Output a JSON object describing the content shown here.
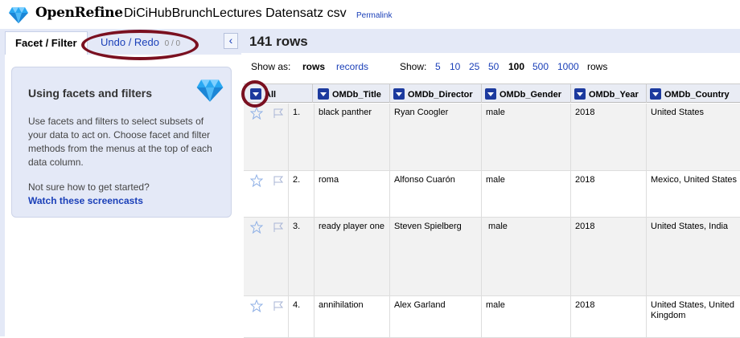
{
  "header": {
    "app_name": "OpenRefine",
    "project_name": "DiCiHubBrunchLectures Datensatz csv",
    "permalink": "Permalink"
  },
  "left_panel": {
    "tabs": {
      "facet": "Facet / Filter",
      "undo": "Undo / Redo",
      "undo_count": "0 / 0"
    },
    "collapse_icon": "chevron-left-icon",
    "help": {
      "title": "Using facets and filters",
      "text": "Use facets and filters to select subsets of your data to act on. Choose facet and filter methods from the menus at the top of each data column.",
      "question": "Not sure how to get started?",
      "link": "Watch these screencasts"
    }
  },
  "summary": {
    "rows": "141 rows"
  },
  "view_bar": {
    "show_as_label": "Show as:",
    "rows_mode": "rows",
    "records_mode": "records",
    "show_label": "Show:",
    "page_sizes": [
      "5",
      "10",
      "25",
      "50",
      "100",
      "500",
      "1000"
    ],
    "selected_size": "100",
    "unit": "rows"
  },
  "grid": {
    "all_label": "All",
    "columns": [
      "OMDb_Title",
      "OMDb_Director",
      "OMDb_Gender",
      "OMDb_Year",
      "OMDb_Country"
    ],
    "rows": [
      {
        "index": "1.",
        "cells": [
          "black panther",
          "Ryan Coogler",
          "male",
          "2018",
          "United States"
        ]
      },
      {
        "index": "2.",
        "cells": [
          "roma",
          "Alfonso Cuarón",
          "male",
          "2018",
          "Mexico, United States"
        ]
      },
      {
        "index": "3.",
        "cells": [
          "ready player one",
          "Steven Spielberg",
          " male",
          "2018",
          "United States, India"
        ]
      },
      {
        "index": "4.",
        "cells": [
          "annihilation",
          "Alex Garland",
          "male",
          "2018",
          "United States, United Kingdom"
        ]
      }
    ]
  },
  "colors": {
    "accent": "#1a3fb8",
    "panel": "#e4e9f7",
    "annotation": "#7a1020",
    "gem": "#2aa6f0"
  }
}
